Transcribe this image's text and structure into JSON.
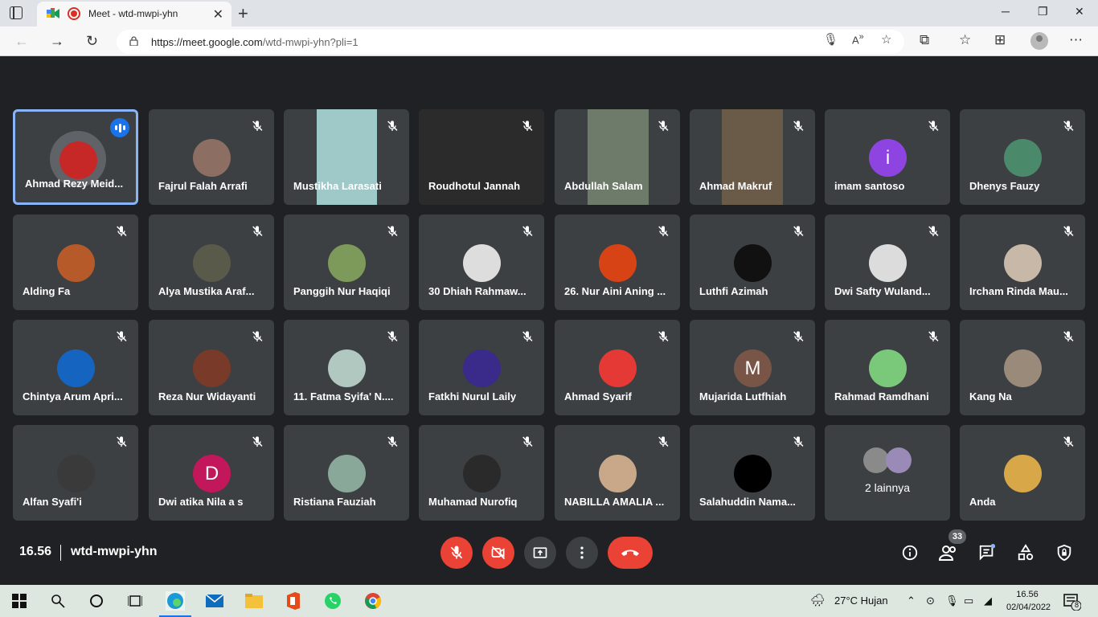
{
  "browser": {
    "tab_title": "Meet - wtd-mwpi-yhn",
    "url_main": "https://meet.google.com",
    "url_rest": "/wtd-mwpi-yhn?pli=1"
  },
  "meeting": {
    "time": "16.56",
    "code": "wtd-mwpi-yhn",
    "participant_count": "33"
  },
  "participants": [
    {
      "name": "Ahmad Rezy Meid...",
      "color": "#c62828",
      "speaking": true
    },
    {
      "name": "Fajrul Falah Arrafi",
      "color": "#8d6e63"
    },
    {
      "name": "Mustikha Larasati",
      "video": true,
      "color": "#9fc8c8"
    },
    {
      "name": "Roudhotul Jannah",
      "video": true,
      "color": "#2b2b2b"
    },
    {
      "name": "Abdullah Salam",
      "video": true,
      "color": "#6e7b6a"
    },
    {
      "name": "Ahmad Makruf",
      "video": true,
      "color": "#6a5a48"
    },
    {
      "name": "imam santoso",
      "initial": "i",
      "color": "#8e44e0"
    },
    {
      "name": "Dhenys Fauzy",
      "color": "#4a8a6a"
    },
    {
      "name": "Alding Fa",
      "color": "#b65a2a"
    },
    {
      "name": "Alya Mustika Araf...",
      "color": "#5a5a4a"
    },
    {
      "name": "Panggih Nur Haqiqi",
      "color": "#7d9a5a"
    },
    {
      "name": "30 Dhiah Rahmaw...",
      "color": "#dddddd"
    },
    {
      "name": "26. Nur Aini Aning ...",
      "color": "#d84315"
    },
    {
      "name": "Luthfi Azimah",
      "color": "#111111"
    },
    {
      "name": "Dwi Safty Wuland...",
      "color": "#dcdcdc"
    },
    {
      "name": "Ircham Rinda Mau...",
      "color": "#c8b8a8"
    },
    {
      "name": "Chintya Arum Apri...",
      "color": "#1565c0"
    },
    {
      "name": "Reza Nur Widayanti",
      "color": "#7a3a2a"
    },
    {
      "name": "11. Fatma Syifa' N....",
      "color": "#b0c8c0"
    },
    {
      "name": "Fatkhi Nurul Laily",
      "color": "#3a2a8a"
    },
    {
      "name": "Ahmad Syarif",
      "color": "#e53935"
    },
    {
      "name": "Mujarida Lutfhiah",
      "initial": "M",
      "color": "#795548"
    },
    {
      "name": "Rahmad Ramdhani",
      "color": "#7ac87a"
    },
    {
      "name": "Kang Na",
      "color": "#9a8a7a"
    },
    {
      "name": "Alfan Syafi'i",
      "color": "#3a3a3a"
    },
    {
      "name": "Dwi atika Nila a s",
      "initial": "D",
      "color": "#c2185b"
    },
    {
      "name": "Ristiana Fauziah",
      "color": "#8aa89a"
    },
    {
      "name": "Muhamad Nurofiq",
      "color": "#2a2a2a"
    },
    {
      "name": "NABILLA AMALIA ...",
      "color": "#c8a888"
    },
    {
      "name": "Salahuddin Nama...",
      "color": "#000000"
    },
    {
      "name": "2 lainnya",
      "others": true,
      "color": "#5f6368"
    },
    {
      "name": "Anda",
      "color": "#d8a848"
    }
  ],
  "taskbar": {
    "weather": "27°C  Hujan",
    "clock_time": "16.56",
    "clock_date": "02/04/2022",
    "notification_count": "8"
  },
  "accent_colors": {
    "meet_red": "#ea4335",
    "speaking_blue": "#1a73e8",
    "tile_bg": "#3c4043"
  }
}
